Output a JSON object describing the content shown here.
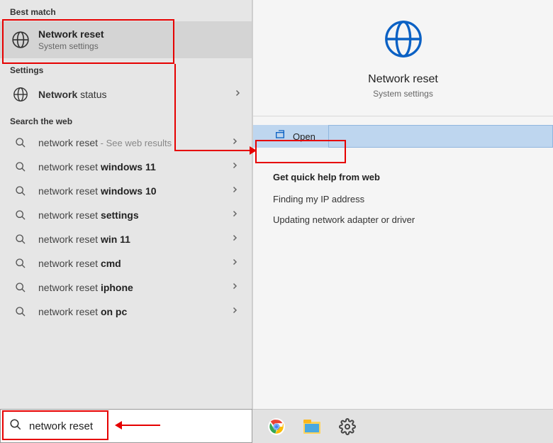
{
  "sections": {
    "best_match_header": "Best match",
    "settings_header": "Settings",
    "search_web_header": "Search the web"
  },
  "best_match": {
    "title": "Network reset",
    "subtitle": "System settings"
  },
  "settings_item": {
    "label_prefix": "Network",
    "label_suffix": " status"
  },
  "web_results": [
    {
      "prefix": "network reset",
      "bold": "",
      "suffix": " - See web results",
      "gray": true
    },
    {
      "prefix": "network reset ",
      "bold": "windows 11",
      "suffix": ""
    },
    {
      "prefix": "network reset ",
      "bold": "windows 10",
      "suffix": ""
    },
    {
      "prefix": "network reset ",
      "bold": "settings",
      "suffix": ""
    },
    {
      "prefix": "network reset ",
      "bold": "win 11",
      "suffix": ""
    },
    {
      "prefix": "network reset ",
      "bold": "cmd",
      "suffix": ""
    },
    {
      "prefix": "network reset ",
      "bold": "iphone",
      "suffix": ""
    },
    {
      "prefix": "network reset ",
      "bold": "on pc",
      "suffix": ""
    }
  ],
  "search_input": {
    "value": "network reset"
  },
  "detail": {
    "title": "Network reset",
    "subtitle": "System settings",
    "open_label": "Open",
    "quick_help_title": "Get quick help from web",
    "quick_help_items": [
      "Finding my IP address",
      "Updating network adapter or driver"
    ]
  }
}
